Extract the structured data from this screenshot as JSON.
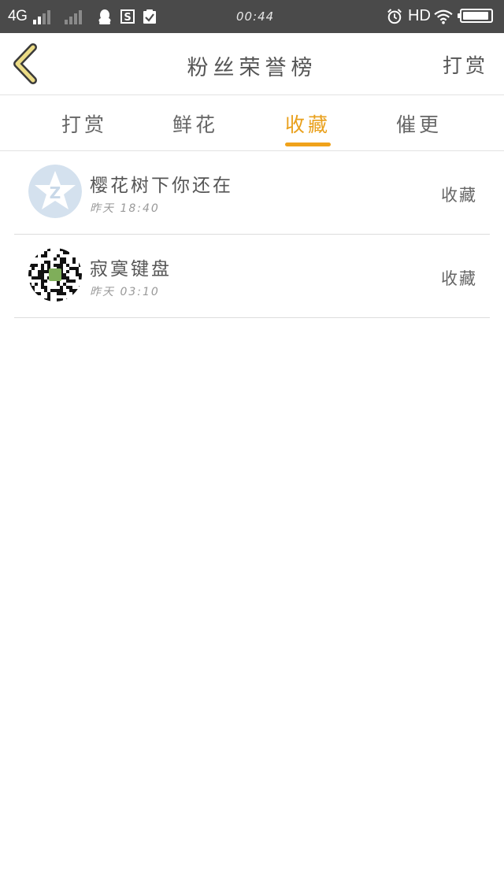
{
  "status_bar": {
    "network": "4G",
    "time": "00:44",
    "hd": "HD",
    "battery_level": 0.95,
    "icons": [
      "signal-icon",
      "qq-icon",
      "s-app-icon",
      "clipboard-check-icon",
      "alarm-icon",
      "wifi-icon",
      "battery-icon"
    ]
  },
  "header": {
    "title": "粉丝荣誉榜",
    "right_action": "打赏",
    "back_icon": "chevron-left-icon"
  },
  "tabs": [
    {
      "label": "打赏",
      "active": false
    },
    {
      "label": "鲜花",
      "active": false
    },
    {
      "label": "收藏",
      "active": true
    },
    {
      "label": "催更",
      "active": false
    }
  ],
  "list": [
    {
      "name": "樱花树下你还在",
      "time": "昨天 18:40",
      "action": "收藏",
      "avatar": "qzone-star-avatar"
    },
    {
      "name": "寂寞键盘",
      "time": "昨天 03:10",
      "action": "收藏",
      "avatar": "qr-code-avatar"
    }
  ],
  "colors": {
    "accent": "#f0a21a",
    "status_bar_bg": "#4a4a4a",
    "back_arrow": "#e9d67a"
  }
}
